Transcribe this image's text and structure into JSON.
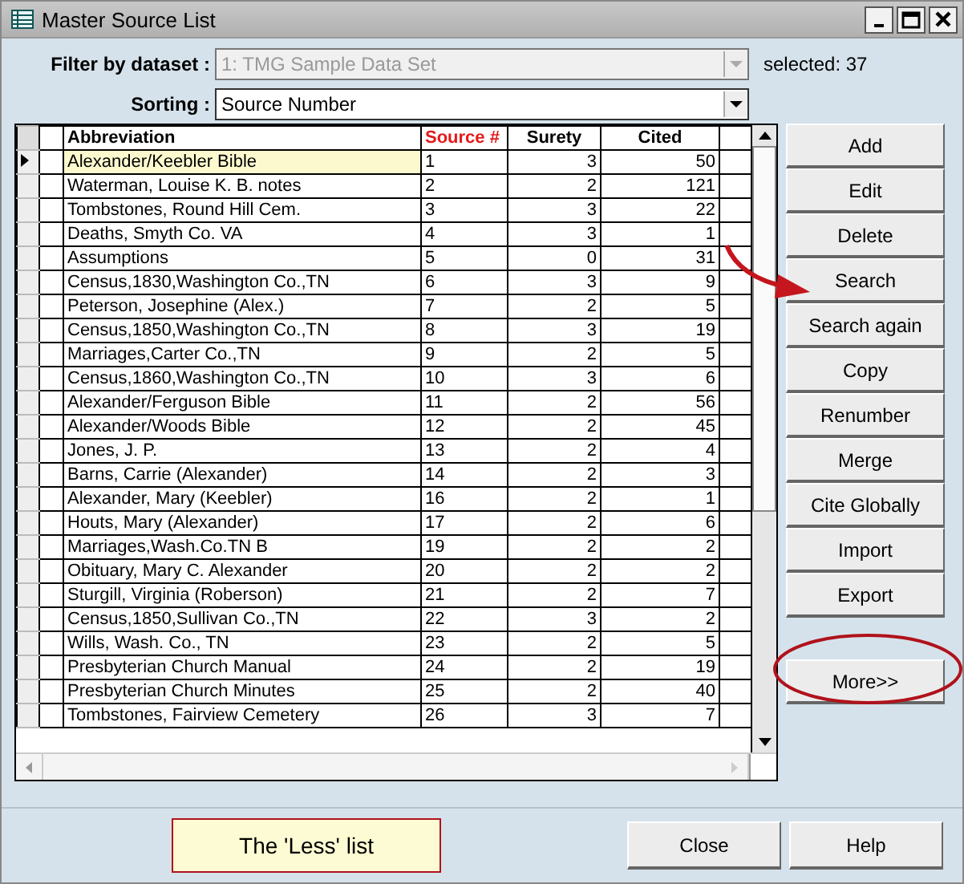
{
  "window": {
    "title": "Master Source List"
  },
  "filter": {
    "label": "Filter by dataset :",
    "value": "1:  TMG Sample Data Set",
    "disabled": true,
    "count": "selected: 37"
  },
  "sorting": {
    "label": "Sorting :",
    "value": "Source Number",
    "disabled": false
  },
  "table": {
    "columns": [
      {
        "label": "Abbreviation",
        "sorted": false
      },
      {
        "label": "Source #",
        "sorted": true
      },
      {
        "label": "Surety",
        "sorted": false
      },
      {
        "label": "Cited",
        "sorted": false
      }
    ],
    "rows": [
      {
        "cells": [
          "Alexander/Keebler Bible",
          "1",
          "3",
          "50"
        ],
        "current": true
      },
      {
        "cells": [
          "Waterman, Louise K. B. notes",
          "2",
          "2",
          "121"
        ],
        "current": false
      },
      {
        "cells": [
          "Tombstones, Round Hill Cem.",
          "3",
          "3",
          "22"
        ],
        "current": false
      },
      {
        "cells": [
          "Deaths, Smyth Co. VA",
          "4",
          "3",
          "1"
        ],
        "current": false
      },
      {
        "cells": [
          "Assumptions",
          "5",
          "0",
          "31"
        ],
        "current": false
      },
      {
        "cells": [
          "Census,1830,Washington Co.,TN",
          "6",
          "3",
          "9"
        ],
        "current": false
      },
      {
        "cells": [
          "Peterson, Josephine (Alex.)",
          "7",
          "2",
          "5"
        ],
        "current": false
      },
      {
        "cells": [
          "Census,1850,Washington Co.,TN",
          "8",
          "3",
          "19"
        ],
        "current": false
      },
      {
        "cells": [
          "Marriages,Carter Co.,TN",
          "9",
          "2",
          "5"
        ],
        "current": false
      },
      {
        "cells": [
          "Census,1860,Washington Co.,TN",
          "10",
          "3",
          "6"
        ],
        "current": false
      },
      {
        "cells": [
          "Alexander/Ferguson Bible",
          "11",
          "2",
          "56"
        ],
        "current": false
      },
      {
        "cells": [
          "Alexander/Woods Bible",
          "12",
          "2",
          "45"
        ],
        "current": false
      },
      {
        "cells": [
          "Jones, J. P.",
          "13",
          "2",
          "4"
        ],
        "current": false
      },
      {
        "cells": [
          "Barns, Carrie (Alexander)",
          "14",
          "2",
          "3"
        ],
        "current": false
      },
      {
        "cells": [
          "Alexander, Mary (Keebler)",
          "16",
          "2",
          "1"
        ],
        "current": false
      },
      {
        "cells": [
          "Houts, Mary (Alexander)",
          "17",
          "2",
          "6"
        ],
        "current": false
      },
      {
        "cells": [
          "Marriages,Wash.Co.TN B",
          "19",
          "2",
          "2"
        ],
        "current": false
      },
      {
        "cells": [
          "Obituary, Mary C. Alexander",
          "20",
          "2",
          "2"
        ],
        "current": false
      },
      {
        "cells": [
          "Sturgill, Virginia (Roberson)",
          "21",
          "2",
          "7"
        ],
        "current": false
      },
      {
        "cells": [
          "Census,1850,Sullivan Co.,TN",
          "22",
          "3",
          "2"
        ],
        "current": false
      },
      {
        "cells": [
          "Wills, Wash. Co., TN",
          "23",
          "2",
          "5"
        ],
        "current": false
      },
      {
        "cells": [
          "Presbyterian Church Manual",
          "24",
          "2",
          "19"
        ],
        "current": false
      },
      {
        "cells": [
          "Presbyterian Church Minutes",
          "25",
          "2",
          "40"
        ],
        "current": false
      },
      {
        "cells": [
          "Tombstones, Fairview Cemetery",
          "26",
          "3",
          "7"
        ],
        "current": false
      }
    ]
  },
  "side_buttons": [
    "Add",
    "Edit",
    "Delete",
    "Search",
    "Search again",
    "Copy",
    "Renumber",
    "Merge",
    "Cite Globally",
    "Import",
    "Export",
    "More>>"
  ],
  "annotation": {
    "text": "The 'Less' list"
  },
  "bottom_buttons": [
    "Close",
    "Help"
  ]
}
